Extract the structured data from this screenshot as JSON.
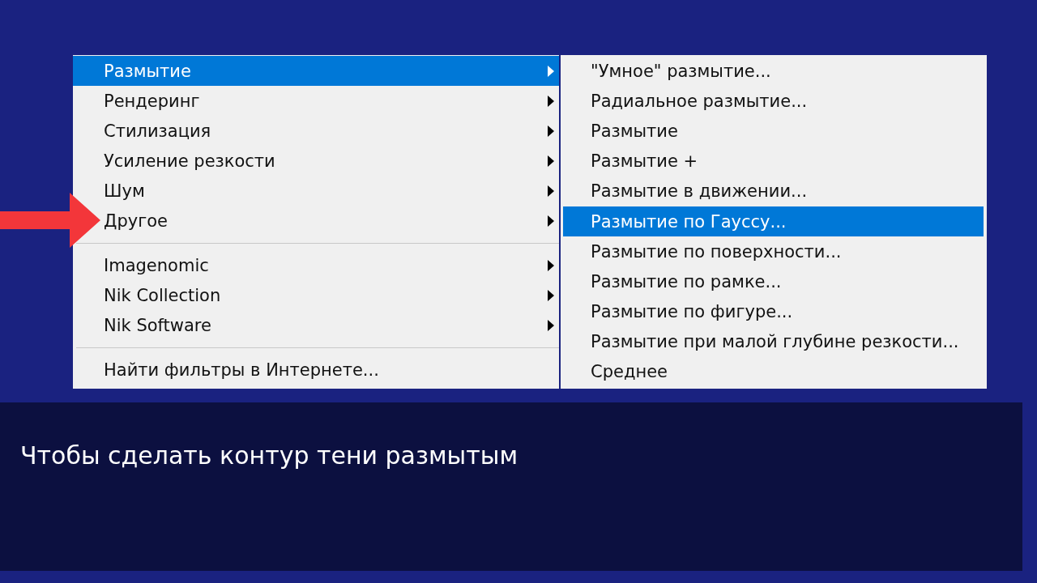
{
  "filter_menu": {
    "groups": [
      [
        {
          "label": "Размытие",
          "selected": true,
          "has_submenu": true
        },
        {
          "label": "Рендеринг",
          "selected": false,
          "has_submenu": true
        },
        {
          "label": "Стилизация",
          "selected": false,
          "has_submenu": true
        },
        {
          "label": "Усиление резкости",
          "selected": false,
          "has_submenu": true
        },
        {
          "label": "Шум",
          "selected": false,
          "has_submenu": true
        },
        {
          "label": "Другое",
          "selected": false,
          "has_submenu": true
        }
      ],
      [
        {
          "label": "Imagenomic",
          "selected": false,
          "has_submenu": true
        },
        {
          "label": "Nik Collection",
          "selected": false,
          "has_submenu": true
        },
        {
          "label": "Nik Software",
          "selected": false,
          "has_submenu": true
        }
      ],
      [
        {
          "label": "Найти фильтры в Интернете...",
          "selected": false,
          "has_submenu": false
        }
      ]
    ]
  },
  "blur_submenu": {
    "items": [
      {
        "label": "\"Умное\" размытие...",
        "selected": false
      },
      {
        "label": "Радиальное размытие...",
        "selected": false
      },
      {
        "label": "Размытие",
        "selected": false
      },
      {
        "label": "Размытие +",
        "selected": false
      },
      {
        "label": "Размытие в движении...",
        "selected": false
      },
      {
        "label": "Размытие по Гауссу...",
        "selected": true
      },
      {
        "label": "Размытие по поверхности...",
        "selected": false
      },
      {
        "label": "Размытие по рамке...",
        "selected": false
      },
      {
        "label": "Размытие по фигуре...",
        "selected": false
      },
      {
        "label": "Размытие при малой глубине резкости...",
        "selected": false
      },
      {
        "label": "Среднее",
        "selected": false
      }
    ]
  },
  "caption": {
    "text": "Чтобы сделать контур тени размытым"
  }
}
